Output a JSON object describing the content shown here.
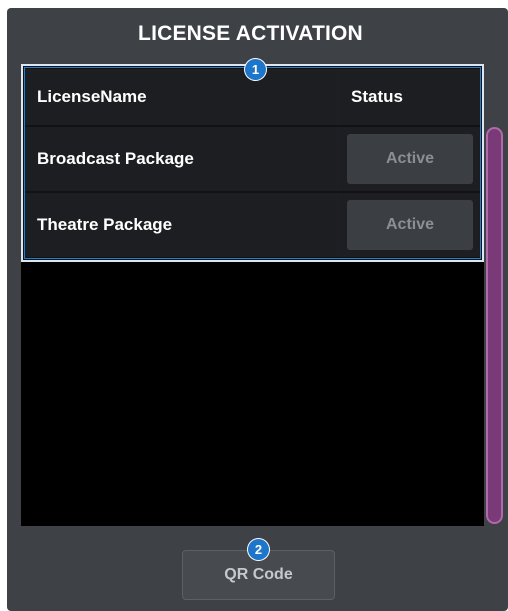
{
  "dialog": {
    "title": "LICENSE ACTIVATION"
  },
  "table": {
    "columns": [
      "LicenseName",
      "Status"
    ],
    "rows": [
      {
        "name": "Broadcast Package",
        "status": "Active"
      },
      {
        "name": "Theatre Package",
        "status": "Active"
      }
    ]
  },
  "footer": {
    "qr_code_label": "QR Code"
  },
  "callouts": [
    "1",
    "2"
  ],
  "colors": {
    "panel_bg": "#3e4145",
    "table_highlight": "#1f7fd6",
    "scrollbar": "#7a3a78",
    "callout": "#1d76c9"
  }
}
